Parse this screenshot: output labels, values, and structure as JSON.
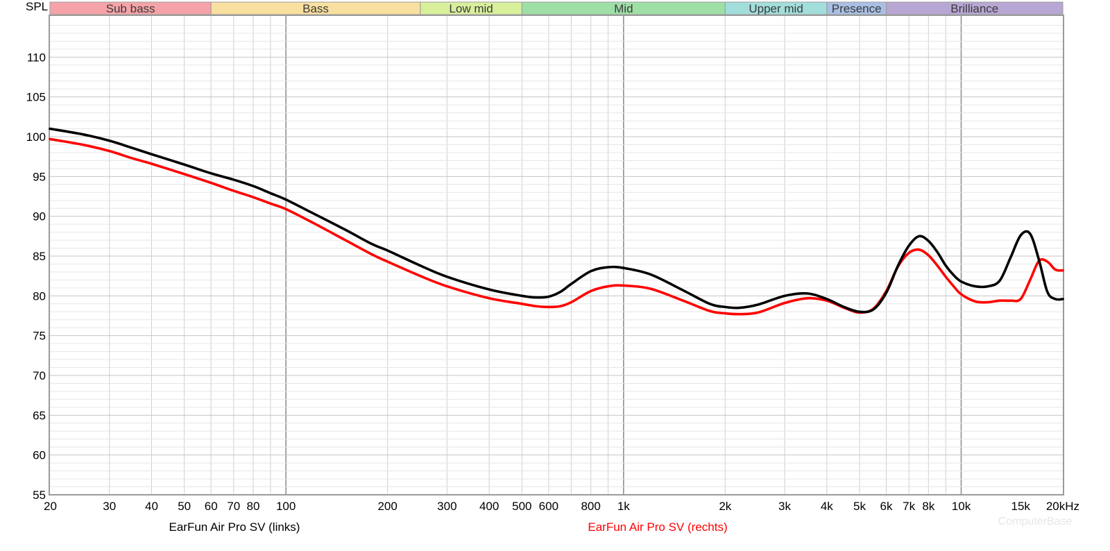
{
  "chart_data": {
    "type": "line",
    "ylabel": "SPL",
    "xunit": "Hz",
    "x_scale": "log",
    "xlim": [
      20,
      20000
    ],
    "ylim": [
      55,
      115
    ],
    "grid": true,
    "x_ticks": [
      {
        "value": 20,
        "label": "20"
      },
      {
        "value": 30,
        "label": "30"
      },
      {
        "value": 40,
        "label": "40"
      },
      {
        "value": 50,
        "label": "50"
      },
      {
        "value": 60,
        "label": "60"
      },
      {
        "value": 70,
        "label": "70"
      },
      {
        "value": 80,
        "label": "80"
      },
      {
        "value": 100,
        "label": "100"
      },
      {
        "value": 200,
        "label": "200"
      },
      {
        "value": 300,
        "label": "300"
      },
      {
        "value": 400,
        "label": "400"
      },
      {
        "value": 500,
        "label": "500"
      },
      {
        "value": 600,
        "label": "600"
      },
      {
        "value": 800,
        "label": "800"
      },
      {
        "value": 1000,
        "label": "1k"
      },
      {
        "value": 2000,
        "label": "2k"
      },
      {
        "value": 3000,
        "label": "3k"
      },
      {
        "value": 4000,
        "label": "4k"
      },
      {
        "value": 5000,
        "label": "5k"
      },
      {
        "value": 6000,
        "label": "6k"
      },
      {
        "value": 7000,
        "label": "7k"
      },
      {
        "value": 8000,
        "label": "8k"
      },
      {
        "value": 10000,
        "label": "10k"
      },
      {
        "value": 15000,
        "label": "15k"
      },
      {
        "value": 20000,
        "label": "20kHz"
      }
    ],
    "y_ticks": [
      55,
      60,
      65,
      70,
      75,
      80,
      85,
      90,
      95,
      100,
      105,
      110
    ],
    "bands": [
      {
        "name": "Sub bass",
        "from": 20,
        "to": 60,
        "color": "#f5a3a8"
      },
      {
        "name": "Bass",
        "from": 60,
        "to": 250,
        "color": "#f9e0a0"
      },
      {
        "name": "Low mid",
        "from": 250,
        "to": 500,
        "color": "#d8ef9c"
      },
      {
        "name": "Mid",
        "from": 500,
        "to": 2000,
        "color": "#9edfa6"
      },
      {
        "name": "Upper mid",
        "from": 2000,
        "to": 4000,
        "color": "#a2dedb"
      },
      {
        "name": "Presence",
        "from": 4000,
        "to": 6000,
        "color": "#a9bfe4"
      },
      {
        "name": "Brilliance",
        "from": 6000,
        "to": 20000,
        "color": "#b8a6d4"
      }
    ],
    "series": [
      {
        "name": "EarFun Air Pro SV (links)",
        "color": "#000000",
        "x": [
          20,
          25,
          30,
          35,
          40,
          50,
          60,
          70,
          80,
          90,
          100,
          120,
          150,
          180,
          200,
          250,
          300,
          400,
          500,
          550,
          600,
          650,
          700,
          800,
          900,
          1000,
          1200,
          1500,
          1800,
          2000,
          2200,
          2500,
          3000,
          3500,
          4000,
          4500,
          5000,
          5500,
          6000,
          6500,
          7000,
          7500,
          8000,
          8500,
          9000,
          9500,
          10000,
          11000,
          12000,
          13000,
          14000,
          15000,
          16000,
          17000,
          18000,
          19000,
          20000
        ],
        "y": [
          101.0,
          100.3,
          99.5,
          98.6,
          97.8,
          96.5,
          95.4,
          94.6,
          93.8,
          92.9,
          92.1,
          90.4,
          88.3,
          86.5,
          85.7,
          83.8,
          82.4,
          80.8,
          80.0,
          79.8,
          79.9,
          80.5,
          81.5,
          83.1,
          83.6,
          83.5,
          82.7,
          80.7,
          79.0,
          78.6,
          78.5,
          78.9,
          80.0,
          80.3,
          79.6,
          78.6,
          78.0,
          78.3,
          80.4,
          83.8,
          86.3,
          87.5,
          86.9,
          85.5,
          83.8,
          82.6,
          81.8,
          81.2,
          81.2,
          81.9,
          84.8,
          87.6,
          87.8,
          84.5,
          80.5,
          79.6,
          79.6
        ]
      },
      {
        "name": "EarFun Air Pro SV (rechts)",
        "color": "#ff0000",
        "x": [
          20,
          25,
          30,
          35,
          40,
          50,
          60,
          70,
          80,
          90,
          100,
          120,
          150,
          180,
          200,
          250,
          300,
          400,
          500,
          550,
          600,
          650,
          700,
          800,
          900,
          1000,
          1200,
          1500,
          1800,
          2000,
          2200,
          2500,
          3000,
          3500,
          4000,
          4500,
          5000,
          5500,
          6000,
          6500,
          7000,
          7500,
          8000,
          8500,
          9000,
          9500,
          10000,
          11000,
          12000,
          13000,
          14000,
          15000,
          16000,
          17000,
          18000,
          19000,
          20000
        ],
        "y": [
          99.7,
          99.0,
          98.2,
          97.3,
          96.6,
          95.3,
          94.2,
          93.2,
          92.4,
          91.6,
          90.9,
          89.2,
          87.0,
          85.2,
          84.3,
          82.5,
          81.2,
          79.7,
          79.0,
          78.7,
          78.6,
          78.7,
          79.2,
          80.6,
          81.2,
          81.3,
          80.9,
          79.4,
          78.1,
          77.8,
          77.7,
          77.9,
          79.1,
          79.7,
          79.4,
          78.5,
          77.9,
          78.4,
          80.6,
          83.7,
          85.4,
          85.8,
          85.1,
          83.8,
          82.4,
          81.2,
          80.2,
          79.3,
          79.2,
          79.4,
          79.4,
          79.6,
          82.0,
          84.4,
          84.3,
          83.3,
          83.2
        ]
      }
    ]
  },
  "watermark": "ComputerBase"
}
